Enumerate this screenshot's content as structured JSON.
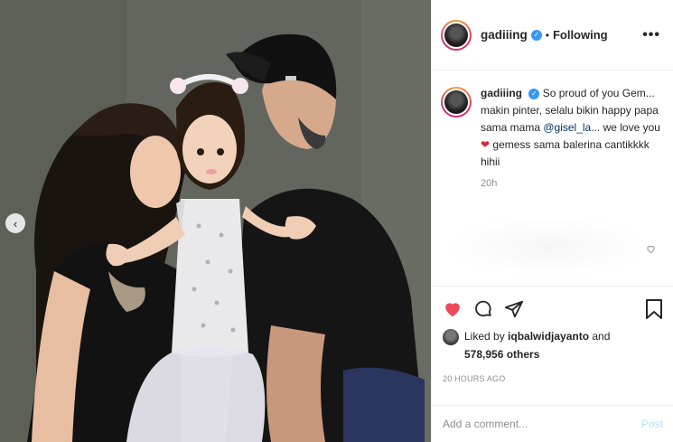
{
  "post": {
    "username": "gadiiing",
    "dot": "•",
    "following_label": "Following",
    "more_glyph": "•••",
    "verified_glyph": "✓",
    "carousel_prev_glyph": "‹",
    "caption": {
      "username": "gadiiing",
      "text_part1": "So proud of you Gem... makin pinter, selalu bikin happy papa sama mama ",
      "mention": "@gisel_la",
      "text_part2": "... we love you ",
      "heart": "❤",
      "text_part3": " gemess sama balerina cantikkkk hihii",
      "time": "20h"
    },
    "likes": {
      "prefix": "Liked by ",
      "user": "iqbalwidjayanto",
      "joiner": " and",
      "count": "578,956 others"
    },
    "time_ago": "20 HOURS AGO",
    "comment_box": {
      "placeholder": "Add a comment...",
      "post_label": "Post"
    }
  },
  "colors": {
    "heart_red": "#ed4956",
    "verified_blue": "#3897f0",
    "post_disabled": "#b2dffc",
    "mention": "#003569",
    "muted": "#8e8e8e"
  },
  "icons": [
    "chevron-left-icon",
    "verified-icon",
    "more-icon",
    "heart-filled-icon",
    "comment-icon",
    "share-icon",
    "bookmark-icon",
    "heart-outline-icon"
  ]
}
